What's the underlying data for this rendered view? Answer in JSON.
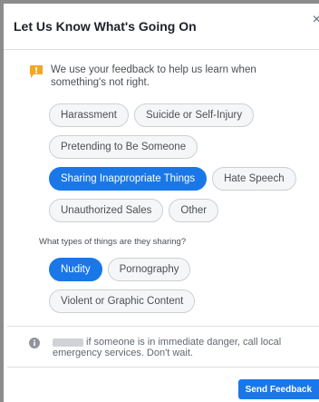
{
  "dialog": {
    "title": "Let Us Know What's Going On",
    "close_label": "×"
  },
  "notice": {
    "text": "We use your feedback to help us learn when something's not right.",
    "flag_color": "#f5a623"
  },
  "categories": [
    {
      "label": "Harassment",
      "selected": false
    },
    {
      "label": "Suicide or Self-Injury",
      "selected": false
    },
    {
      "label": "Pretending to Be Someone",
      "selected": false
    },
    {
      "label": "Sharing Inappropriate Things",
      "selected": true
    },
    {
      "label": "Hate Speech",
      "selected": false
    },
    {
      "label": "Unauthorized Sales",
      "selected": false
    },
    {
      "label": "Other",
      "selected": false
    }
  ],
  "followup": {
    "question": "What types of things are they sharing?",
    "options": [
      {
        "label": "Nudity",
        "selected": true
      },
      {
        "label": "Pornography",
        "selected": false
      },
      {
        "label": "Violent or Graphic Content",
        "selected": false
      }
    ]
  },
  "footer": {
    "note": "if someone is in immediate danger, call local emergency services. Don't wait.",
    "send_label": "Send Feedback"
  },
  "colors": {
    "accent": "#1a77e8",
    "chip_bg": "#f5f6f7",
    "chip_border": "#ccd0d5"
  }
}
